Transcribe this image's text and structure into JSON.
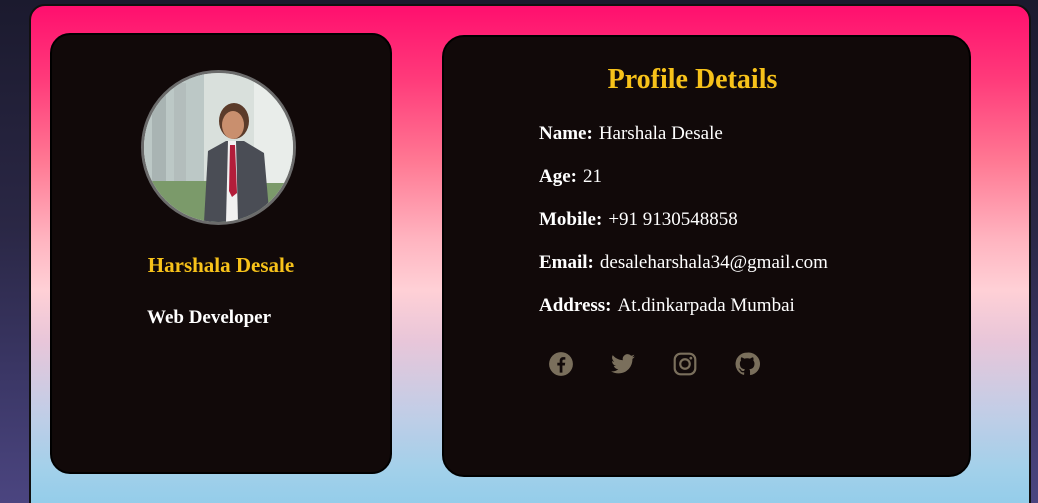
{
  "profile": {
    "name": "Harshala Desale",
    "role": "Web Developer"
  },
  "details": {
    "title": "Profile Details",
    "rows": [
      {
        "label": "Name:",
        "value": "Harshala Desale"
      },
      {
        "label": "Age:",
        "value": "21"
      },
      {
        "label": "Mobile:",
        "value": "+91 9130548858"
      },
      {
        "label": "Email:",
        "value": "desaleharshala34@gmail.com"
      },
      {
        "label": "Address:",
        "value": "At.dinkarpada Mumbai"
      }
    ]
  },
  "socials": [
    "facebook-icon",
    "twitter-icon",
    "instagram-icon",
    "github-icon"
  ],
  "colors": {
    "accent": "#f7c21a",
    "card": "#110909",
    "icon": "#7a6f5c"
  }
}
